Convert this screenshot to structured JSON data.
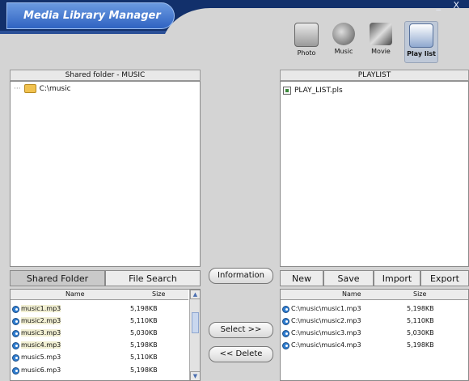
{
  "window": {
    "title": "Media Library Manager",
    "controls": "_ X"
  },
  "modes": [
    {
      "label": "Photo",
      "icon": "photo-icon"
    },
    {
      "label": "Music",
      "icon": "music-icon"
    },
    {
      "label": "Movie",
      "icon": "movie-icon"
    },
    {
      "label": "Play list",
      "icon": "playlist-icon",
      "active": true
    }
  ],
  "shared": {
    "header": "Shared folder - MUSIC",
    "tree_item": "C:\\music"
  },
  "playlist": {
    "header": "PLAYLIST",
    "file": "PLAY_LIST.pls"
  },
  "tabs": {
    "shared_folder": "Shared Folder",
    "file_search": "File Search"
  },
  "buttons": {
    "information": "Information",
    "select": "Select >>",
    "delete": "<< Delete",
    "new": "New",
    "save": "Save",
    "import": "Import",
    "export": "Export"
  },
  "left_list": {
    "col_name": "Name",
    "col_size": "Size",
    "rows": [
      {
        "name": "music1.mp3",
        "size": "5,198KB",
        "selected": true
      },
      {
        "name": "music2.mp3",
        "size": "5,110KB",
        "selected": true
      },
      {
        "name": "music3.mp3",
        "size": "5,030KB",
        "selected": true
      },
      {
        "name": "music4.mp3",
        "size": "5,198KB",
        "selected": true
      },
      {
        "name": "music5.mp3",
        "size": "5,110KB",
        "selected": false
      },
      {
        "name": "music6.mp3",
        "size": "5,198KB",
        "selected": false
      }
    ]
  },
  "right_list": {
    "col_name": "Name",
    "col_size": "Size",
    "rows": [
      {
        "name": "C:\\music\\music1.mp3",
        "size": "5,198KB"
      },
      {
        "name": "C:\\music\\music2.mp3",
        "size": "5,110KB"
      },
      {
        "name": "C:\\music\\music3.mp3",
        "size": "5,030KB"
      },
      {
        "name": "C:\\music\\music4.mp3",
        "size": "5,198KB"
      }
    ]
  }
}
